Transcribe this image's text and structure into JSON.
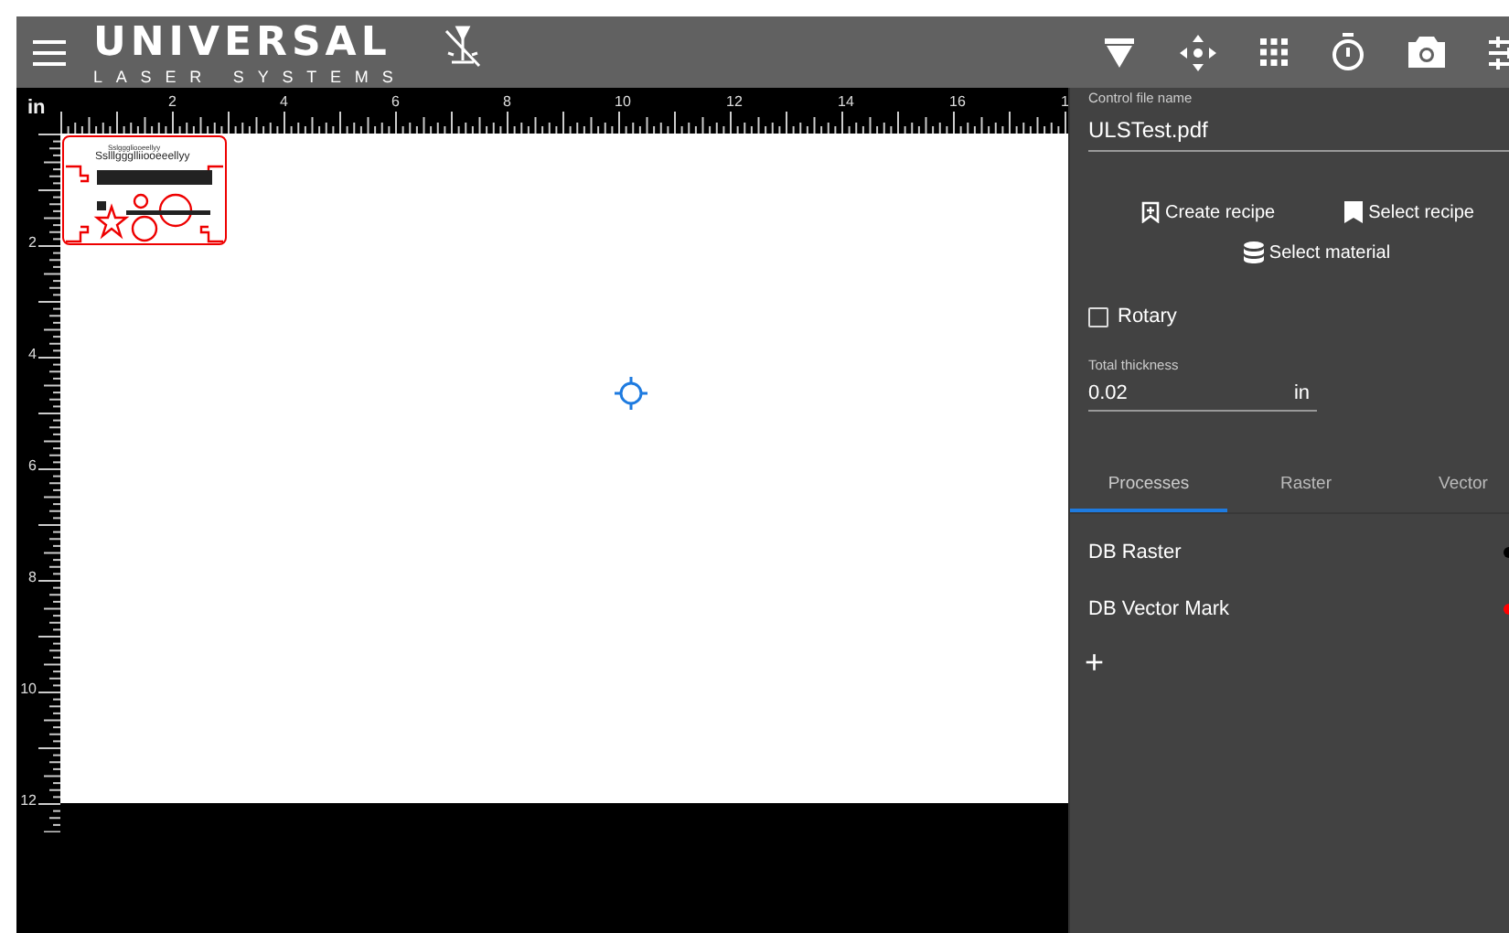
{
  "header": {
    "logo_main": "UNIVERSAL",
    "logo_sub": "LASER SYSTEMS"
  },
  "ruler": {
    "unit": "in",
    "top_labels": [
      "2",
      "4",
      "6",
      "8",
      "10",
      "12",
      "14",
      "16",
      "1"
    ],
    "left_labels": [
      "2",
      "4",
      "6",
      "8",
      "10",
      "12"
    ]
  },
  "design": {
    "texts": [
      "Sslgggliooeellyy",
      "Sslllggglliiooeeellyy"
    ]
  },
  "panel": {
    "file_label": "Control file name",
    "file_name": "ULSTest.pdf",
    "actions": [
      {
        "kind": "create",
        "label": "Create recipe"
      },
      {
        "kind": "select",
        "label": "Select recipe"
      },
      {
        "kind": "material",
        "label": "Select material"
      }
    ],
    "rotary": {
      "label": "Rotary",
      "checked": false
    },
    "thickness": {
      "label": "Total thickness",
      "value": "0.02",
      "unit": "in"
    },
    "tabs": [
      {
        "label": "Processes",
        "selected": true
      },
      {
        "label": "Raster",
        "selected": false
      },
      {
        "label": "Vector",
        "selected": false
      }
    ],
    "processes": [
      {
        "name": "DB Raster",
        "color": "#000000"
      },
      {
        "name": "DB Vector Mark",
        "color": "#ff0000"
      }
    ],
    "add_symbol": "+"
  }
}
